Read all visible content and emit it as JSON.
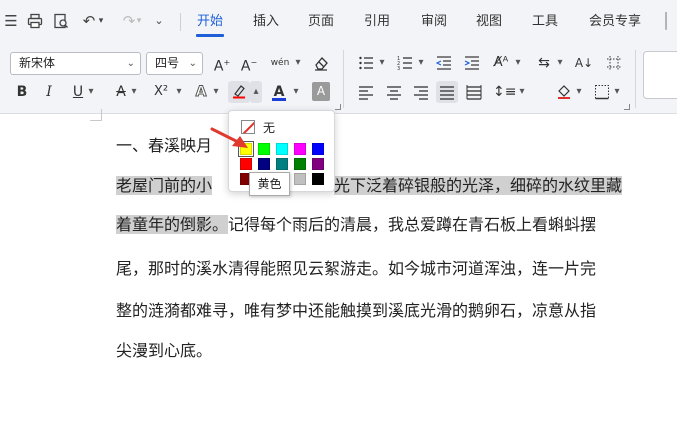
{
  "menu": {
    "tabs": [
      {
        "label": "开始",
        "active": true
      },
      {
        "label": "插入"
      },
      {
        "label": "页面"
      },
      {
        "label": "引用"
      },
      {
        "label": "审阅"
      },
      {
        "label": "视图"
      },
      {
        "label": "工具"
      },
      {
        "label": "会员专享"
      }
    ]
  },
  "toolbar": {
    "font_name": "新宋体",
    "font_size": "四号",
    "bold_label": "B",
    "italic_label": "I",
    "underline_label": "U",
    "strike_label": "A",
    "superscript_label": "X²",
    "text_effect_label": "A",
    "font_color_label": "A",
    "char_shade_label": "A",
    "grow_label": "A",
    "shrink_label": "A",
    "phonetic_label": "wén",
    "font_color": "#1a3fd6"
  },
  "color_popup": {
    "none_label": "无",
    "tooltip": "黄色",
    "swatches": [
      {
        "color": "#ffff00"
      },
      {
        "color": "#00ff00"
      },
      {
        "color": "#00ffff"
      },
      {
        "color": "#ff00ff"
      },
      {
        "color": "#0000ff"
      },
      {
        "color": "#ff0000"
      },
      {
        "color": "#000080"
      },
      {
        "color": "#008080"
      },
      {
        "color": "#008000"
      },
      {
        "color": "#800080"
      },
      {
        "color": "#800000"
      },
      {
        "color": "#808000"
      },
      {
        "color": "#808080"
      },
      {
        "color": "#c0c0c0"
      },
      {
        "color": "#000000"
      }
    ]
  },
  "document": {
    "heading": "一、春溪映月",
    "lines": [
      {
        "parts": [
          "老屋门前的小",
          "",
          "光下泛着碎银般的光泽，细碎的水纹里藏"
        ],
        "highlighted": true
      },
      {
        "parts": [
          "着童年的倒影。",
          "记得每个雨后的清晨，我总爱蹲在青石板上看蝌蚪摆"
        ],
        "highlighted_first": true
      },
      {
        "parts": [
          "尾，那时的溪水清得能照见云絮游走。如今城市河道浑浊，连一片完"
        ]
      },
      {
        "parts": [
          "整的涟漪都难寻，唯有梦中还能触摸到溪底光滑的鹅卵石，凉意从指"
        ]
      },
      {
        "parts": [
          "尖漫到心底。"
        ]
      }
    ]
  }
}
